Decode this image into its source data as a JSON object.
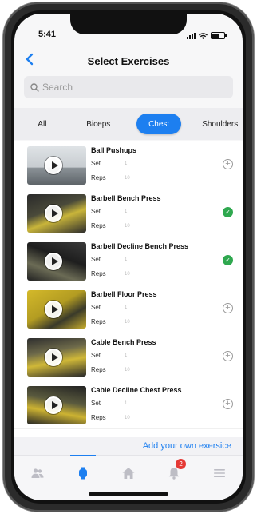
{
  "status_bar": {
    "time": "5:41"
  },
  "header": {
    "back_icon": "chevron-left-icon",
    "title": "Select Exercises"
  },
  "search": {
    "placeholder": "Search",
    "icon": "search-icon"
  },
  "categories": {
    "items": [
      {
        "label": "All",
        "active": false
      },
      {
        "label": "Biceps",
        "active": false
      },
      {
        "label": "Chest",
        "active": true
      },
      {
        "label": "Shoulders",
        "active": false
      }
    ]
  },
  "exercises": {
    "items": [
      {
        "name": "Ball Pushups",
        "set_label": "Set",
        "set_value": "1",
        "reps_label": "Reps",
        "reps_value": "10",
        "status": "add",
        "status_icon": "plus-circle-icon"
      },
      {
        "name": "Barbell Bench Press",
        "set_label": "Set",
        "set_value": "1",
        "reps_label": "Reps",
        "reps_value": "10",
        "status": "selected",
        "status_icon": "check-circle-icon"
      },
      {
        "name": "Barbell Decline Bench Press",
        "set_label": "Set",
        "set_value": "1",
        "reps_label": "Reps",
        "reps_value": "10",
        "status": "selected",
        "status_icon": "check-circle-icon"
      },
      {
        "name": "Barbell Floor Press",
        "set_label": "Set",
        "set_value": "1",
        "reps_label": "Reps",
        "reps_value": "10",
        "status": "add",
        "status_icon": "plus-circle-icon"
      },
      {
        "name": "Cable Bench Press",
        "set_label": "Set",
        "set_value": "1",
        "reps_label": "Reps",
        "reps_value": "10",
        "status": "add",
        "status_icon": "plus-circle-icon"
      },
      {
        "name": "Cable Decline Chest Press",
        "set_label": "Set",
        "set_value": "1",
        "reps_label": "Reps",
        "reps_value": "10",
        "status": "add",
        "status_icon": "plus-circle-icon"
      }
    ]
  },
  "footer_link": {
    "label": "Add your own exersice"
  },
  "tabbar": {
    "items": [
      {
        "icon": "people-icon",
        "active": false
      },
      {
        "icon": "watch-icon",
        "active": true
      },
      {
        "icon": "home-icon",
        "active": false
      },
      {
        "icon": "bell-icon",
        "active": false,
        "badge": "2"
      },
      {
        "icon": "menu-icon",
        "active": false
      }
    ]
  },
  "colors": {
    "accent": "#1d7ff0",
    "success": "#2fa84f",
    "badge": "#e53935"
  }
}
